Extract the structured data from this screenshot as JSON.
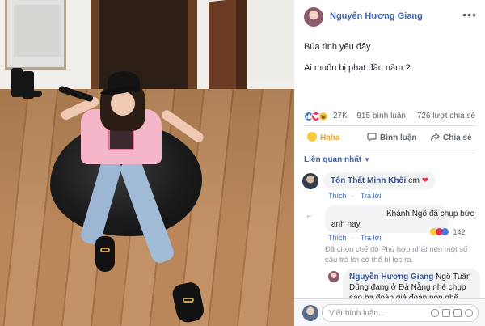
{
  "post": {
    "author": "Nguyễn Hương Giang",
    "text_lines": [
      "Búa tình yêu đây",
      "Ai muốn bị phạt đầu năm ?"
    ],
    "reaction_count": "27K",
    "comment_count": "915 bình luận",
    "share_count": "726 lượt chia sẻ",
    "reactions": [
      "like-icon",
      "love-icon",
      "haha-icon"
    ],
    "more_glyph": "•••"
  },
  "actions": {
    "haha_label": "Haha",
    "comment_label": "Bình luận",
    "share_label": "Chia sẻ"
  },
  "comments_sort": "Liên quan nhất",
  "comments": [
    {
      "author": "Tôn Thất Minh Khôi",
      "text": "em",
      "like": "Thích",
      "reply": "Trả lời"
    },
    {
      "author": "Khánh Ngô",
      "text_lines": [
        "Khánh Ngô đã chụp bức",
        "anh nay"
      ],
      "reaction_count": "142",
      "like": "Thích",
      "reply": "Trả lời"
    },
    {
      "author": "Nguyễn Hương Giang",
      "text": "Ngô Tuấn Dũng đang ở Đà Nẵng nhé chụp sao ba đoán già đoán non ghê"
    }
  ],
  "filter_note": "Đã chọn chế độ Phù hợp nhất nên một số câu trả lời có thể bị lọc ra.",
  "composer": {
    "placeholder": "Viết bình luận..."
  },
  "colors": {
    "link": "#4267b2",
    "name": "#385898",
    "muted": "#606770",
    "haha": "#f0a732"
  }
}
